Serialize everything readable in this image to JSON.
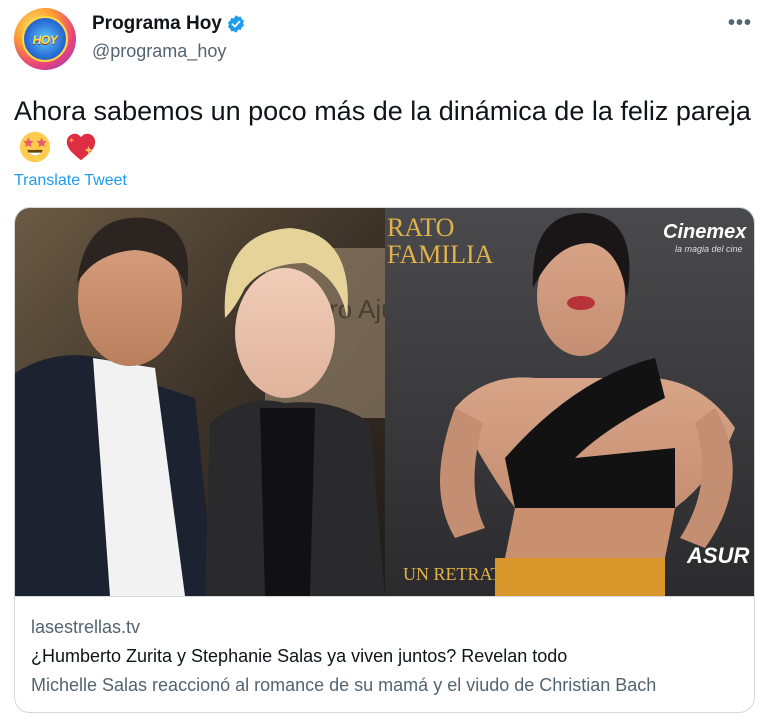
{
  "tweet": {
    "author": {
      "display_name": "Programa Hoy",
      "handle": "@programa_hoy",
      "avatar_text": "HOY",
      "verified": true
    },
    "more_label": "•••",
    "text": "Ahora sabemos un poco más de la dinámica de la feliz pareja",
    "emojis": [
      "star-struck-emoji",
      "sparkling-heart-emoji"
    ],
    "translate_label": "Translate Tweet"
  },
  "link_card": {
    "domain": "lasestrellas.tv",
    "title": "¿Humberto Zurita y Stephanie Salas ya viven juntos? Revelan todo",
    "description": "Michelle Salas reaccionó al romance de su mamá y el viudo de Christian Bach",
    "image": {
      "backdrop_left": "Teatro Ajusco",
      "backdrop_right_brand": "Cinemex",
      "backdrop_right_tagline": "la magia del cine",
      "poster_text_1": "RATO",
      "poster_text_2": "FAMILIA",
      "poster_text_3": "UN RETRATO DE FAMILIA",
      "sponsor": "ASUR"
    }
  },
  "colors": {
    "link_blue": "#1d9bf0",
    "secondary_text": "#536471",
    "primary_text": "#0f1419",
    "border": "#cfd9de",
    "verified": "#1d9bf0"
  }
}
